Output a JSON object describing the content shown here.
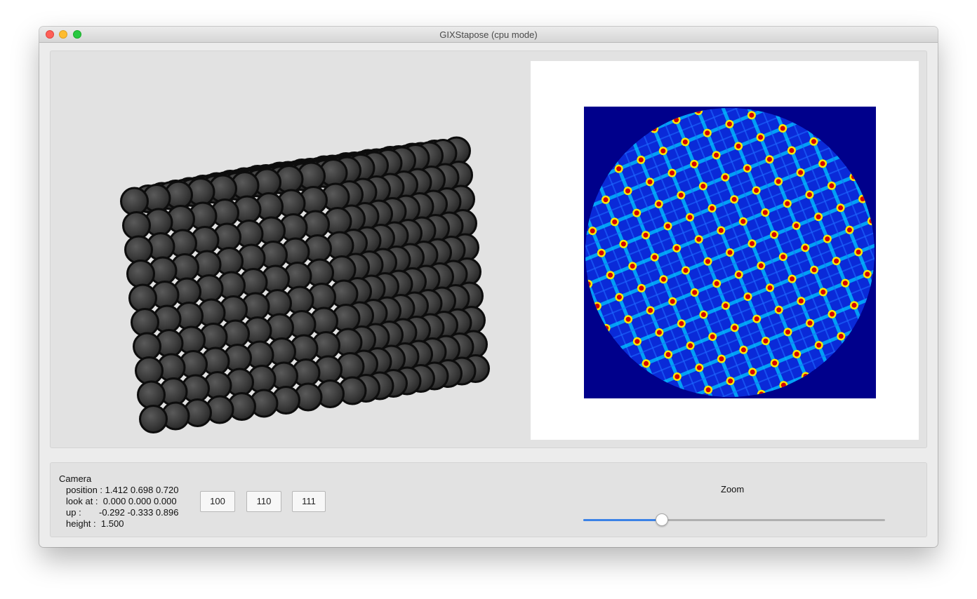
{
  "window": {
    "title": "GIXStapose (cpu mode)"
  },
  "camera": {
    "heading": "Camera",
    "position_label": "position :",
    "position_value": "1.412 0.698 0.720",
    "look_at_label": "look at :",
    "look_at_value": "0.000 0.000 0.000",
    "up_label": "up :",
    "up_value": "-0.292 -0.333 0.896",
    "height_label": "height :",
    "height_value": "1.500"
  },
  "buttons": {
    "b100": "100",
    "b110": "110",
    "b111": "111"
  },
  "zoom": {
    "label": "Zoom",
    "value_fraction": 0.26
  },
  "colors": {
    "diffraction_background": "#00008b",
    "slider_accent": "#3b82e6",
    "sphere": "#3a3a3a"
  }
}
